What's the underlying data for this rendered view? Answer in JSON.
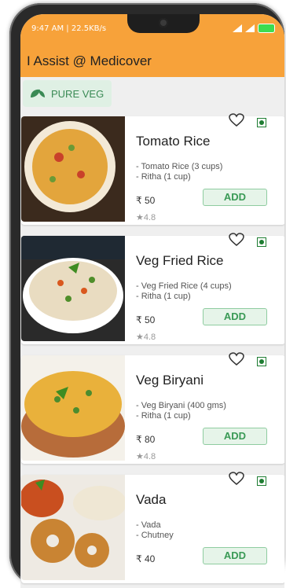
{
  "status_bar": {
    "left_text": "9:47 AM | 22.5KB/s",
    "battery": "88"
  },
  "app": {
    "title": "I Assist @ Medicover"
  },
  "filter": {
    "label": "PURE VEG"
  },
  "items": [
    {
      "name": "Tomato Rice",
      "desc1": "- Tomato Rice (3 cups)",
      "desc2": "- Ritha (1 cup)",
      "price": "₹ 50",
      "rating": "★4.8",
      "add_label": "ADD"
    },
    {
      "name": "Veg Fried Rice",
      "desc1": "- Veg Fried Rice (4 cups)",
      "desc2": "- Ritha (1 cup)",
      "price": "₹ 50",
      "rating": "★4.8",
      "add_label": "ADD"
    },
    {
      "name": "Veg Biryani",
      "desc1": "- Veg Biryani (400 gms)",
      "desc2": "- Ritha (1 cup)",
      "price": "₹ 80",
      "rating": "★4.8",
      "add_label": "ADD"
    },
    {
      "name": "Vada",
      "desc1": "- Vada",
      "desc2": "- Chutney",
      "price": "₹ 40",
      "rating": "",
      "add_label": "ADD"
    }
  ],
  "colors": {
    "accent": "#f7a23a",
    "veg_green": "#1e7d32",
    "add_green": "#3a9a56"
  },
  "icons": {
    "favorite": "heart-outline-icon",
    "veg": "veg-indicator-icon",
    "leaf": "leaf-icon"
  }
}
